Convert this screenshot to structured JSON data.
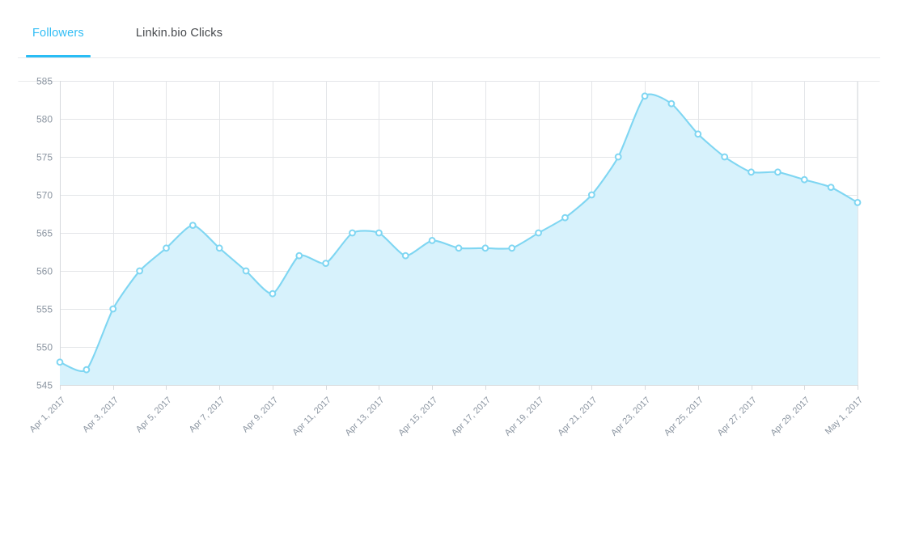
{
  "tabs": [
    {
      "label": "Followers",
      "active": true
    },
    {
      "label": "Linkin.bio Clicks",
      "active": false
    }
  ],
  "colors": {
    "accent": "#29bdf5",
    "tab_active_text": "#30bdf5",
    "tab_inactive_text": "#46494d",
    "line": "#7fd6f2",
    "area_fill": "#d7f2fc",
    "grid": "#e3e5e8",
    "tick_text": "#8b95a1"
  },
  "chart_data": {
    "type": "area",
    "title": "",
    "xlabel": "",
    "ylabel": "",
    "grid": true,
    "legend": "none",
    "ylim": [
      545,
      585
    ],
    "yticks": [
      545,
      550,
      555,
      560,
      565,
      570,
      575,
      580,
      585
    ],
    "ytick_labels": [
      "545",
      "550",
      "555",
      "560",
      "565",
      "570",
      "575",
      "580",
      "585"
    ],
    "xtick_labels": [
      "Apr 1, 2017",
      "Apr 3, 2017",
      "Apr 5, 2017",
      "Apr 7, 2017",
      "Apr 9, 2017",
      "Apr 11, 2017",
      "Apr 13, 2017",
      "Apr 15, 2017",
      "Apr 17, 2017",
      "Apr 19, 2017",
      "Apr 21, 2017",
      "Apr 23, 2017",
      "Apr 25, 2017",
      "Apr 27, 2017",
      "Apr 29, 2017",
      "May 1, 2017"
    ],
    "xtick_rotation": -45,
    "categories": [
      "Apr 1, 2017",
      "Apr 2, 2017",
      "Apr 3, 2017",
      "Apr 4, 2017",
      "Apr 5, 2017",
      "Apr 6, 2017",
      "Apr 7, 2017",
      "Apr 8, 2017",
      "Apr 9, 2017",
      "Apr 10, 2017",
      "Apr 11, 2017",
      "Apr 12, 2017",
      "Apr 13, 2017",
      "Apr 14, 2017",
      "Apr 15, 2017",
      "Apr 16, 2017",
      "Apr 17, 2017",
      "Apr 18, 2017",
      "Apr 19, 2017",
      "Apr 20, 2017",
      "Apr 21, 2017",
      "Apr 22, 2017",
      "Apr 23, 2017",
      "Apr 24, 2017",
      "Apr 25, 2017",
      "Apr 26, 2017",
      "Apr 27, 2017",
      "Apr 28, 2017",
      "Apr 29, 2017",
      "Apr 30, 2017",
      "May 1, 2017"
    ],
    "series": [
      {
        "name": "Followers",
        "values": [
          548,
          547,
          555,
          560,
          563,
          566,
          563,
          560,
          557,
          562,
          561,
          565,
          565,
          562,
          564,
          563,
          563,
          563,
          565,
          567,
          570,
          575,
          583,
          582,
          578,
          575,
          573,
          573,
          572,
          571,
          569
        ]
      }
    ]
  }
}
